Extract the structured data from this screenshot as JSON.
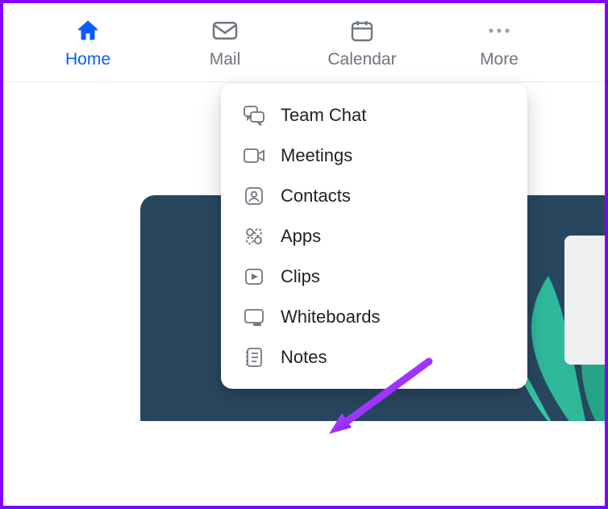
{
  "nav": {
    "home": {
      "label": "Home",
      "active": true
    },
    "mail": {
      "label": "Mail",
      "active": false
    },
    "calendar": {
      "label": "Calendar",
      "active": false
    },
    "more": {
      "label": "More",
      "active": false
    }
  },
  "more_menu": {
    "items": [
      {
        "id": "team-chat",
        "label": "Team Chat",
        "icon": "chat-icon"
      },
      {
        "id": "meetings",
        "label": "Meetings",
        "icon": "video-icon"
      },
      {
        "id": "contacts",
        "label": "Contacts",
        "icon": "contact-icon"
      },
      {
        "id": "apps",
        "label": "Apps",
        "icon": "apps-icon"
      },
      {
        "id": "clips",
        "label": "Clips",
        "icon": "clips-icon"
      },
      {
        "id": "whiteboards",
        "label": "Whiteboards",
        "icon": "whiteboard-icon"
      },
      {
        "id": "notes",
        "label": "Notes",
        "icon": "notes-icon"
      }
    ]
  },
  "annotation": {
    "arrow_target": "notes",
    "arrow_color": "#9b2cff"
  },
  "colors": {
    "accent": "#0b5cff",
    "muted": "#6e7680",
    "banner": "#28475f",
    "frame": "#8000ff"
  }
}
